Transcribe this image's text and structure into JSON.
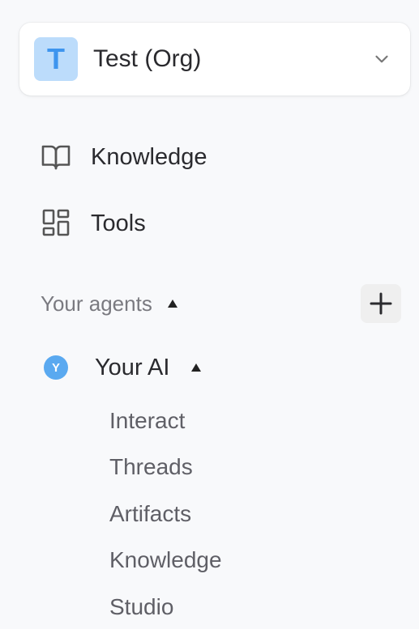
{
  "org": {
    "initial": "T",
    "name": "Test (Org)",
    "chevron_icon": "chevron-down-icon",
    "avatar_bg": "#bcdcfb",
    "avatar_fg": "#3e95ee"
  },
  "nav": {
    "items": [
      {
        "label": "Knowledge",
        "icon": "book-icon"
      },
      {
        "label": "Tools",
        "icon": "grid-icon"
      }
    ]
  },
  "agents_section": {
    "label": "Your agents",
    "caret_icon": "caret-up-icon",
    "add_icon": "plus-icon"
  },
  "agent": {
    "initial": "Y",
    "name": "Your AI",
    "caret_icon": "caret-up-icon",
    "avatar_bg": "#5aa9f0",
    "sub_items": [
      "Interact",
      "Threads",
      "Artifacts",
      "Knowledge",
      "Studio"
    ]
  }
}
